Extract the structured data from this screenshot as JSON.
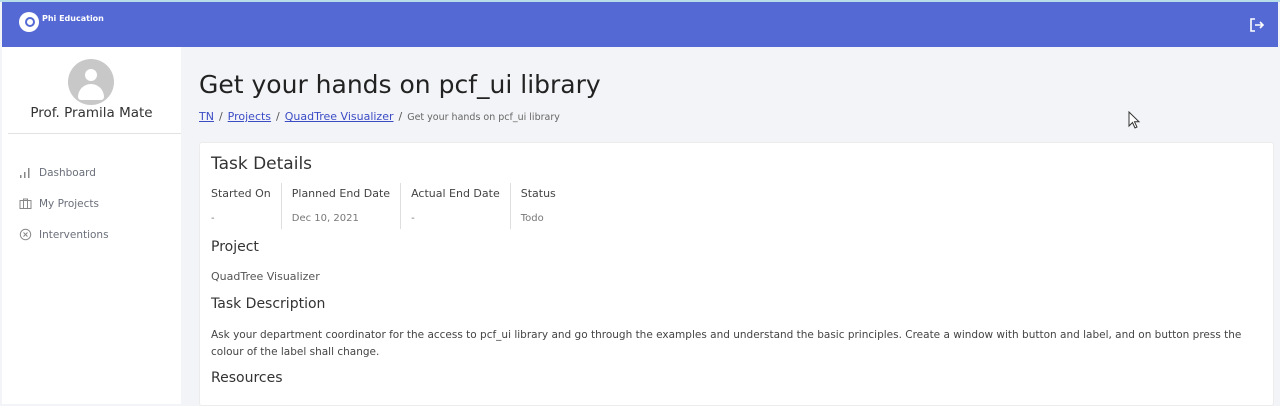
{
  "brand": {
    "name": "Phi Education"
  },
  "icons": {
    "logout": "logout-icon",
    "dashboard": "bar-chart-icon",
    "projects": "briefcase-icon",
    "interventions": "circle-x-icon"
  },
  "colors": {
    "topbar": "#5469d4",
    "link": "#3c4cc6",
    "background": "#f3f4f7"
  },
  "user": {
    "name": "Prof. Pramila Mate"
  },
  "sidebar": {
    "items": [
      {
        "label": "Dashboard",
        "icon": "bar-chart-icon"
      },
      {
        "label": "My Projects",
        "icon": "briefcase-icon"
      },
      {
        "label": "Interventions",
        "icon": "circle-x-icon"
      }
    ]
  },
  "page": {
    "title": "Get your hands on pcf_ui library",
    "breadcrumb": {
      "items": [
        "TN",
        "Projects",
        "QuadTree Visualizer"
      ],
      "separator": "/",
      "current": "Get your hands on pcf_ui library"
    }
  },
  "task": {
    "heading": "Task Details",
    "fields": [
      {
        "label": "Started On",
        "value": "-"
      },
      {
        "label": "Planned End Date",
        "value": "Dec 10, 2021"
      },
      {
        "label": "Actual End Date",
        "value": "-"
      },
      {
        "label": "Status",
        "value": "Todo"
      }
    ],
    "project_heading": "Project",
    "project_value": "QuadTree Visualizer",
    "description_heading": "Task Description",
    "description": "Ask your department coordinator for the access to pcf_ui library and go through the examples and understand the basic principles. Create a window with button and label, and on button press the colour of the label shall change.",
    "resources_heading": "Resources"
  }
}
